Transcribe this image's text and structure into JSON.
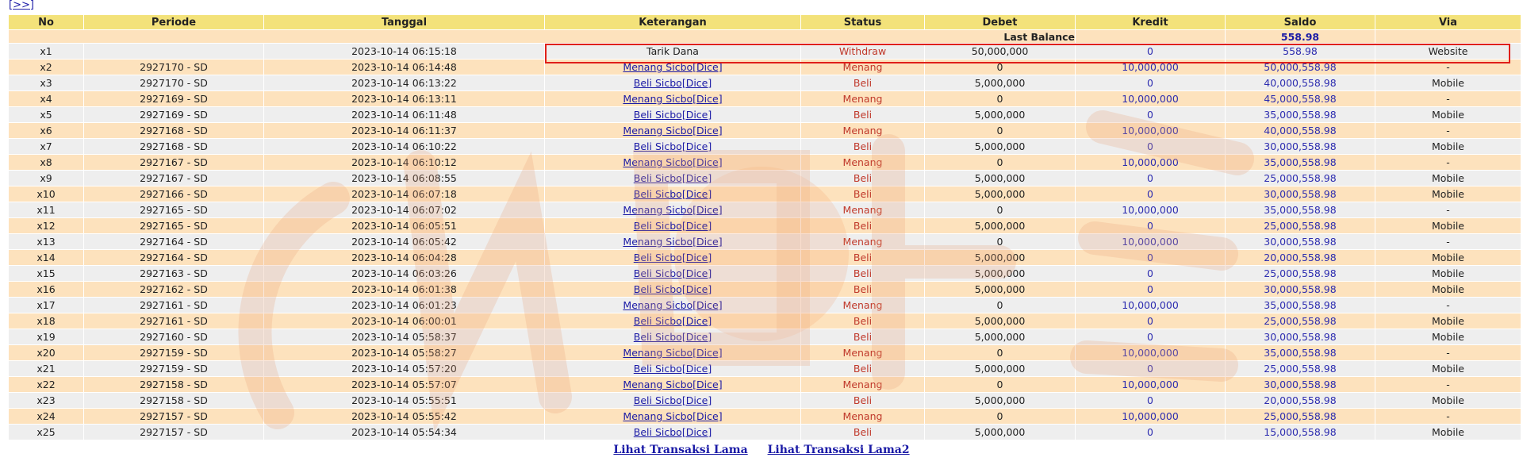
{
  "nav": {
    "next_link": "[>>]"
  },
  "table": {
    "headers": [
      "No",
      "Periode",
      "Tanggal",
      "Keterangan",
      "Status",
      "Debet",
      "Kredit",
      "Saldo",
      "Via"
    ],
    "last_balance_label": "Last Balance",
    "last_balance_value": "558.98",
    "rows": [
      {
        "no": "x1",
        "periode": "",
        "tanggal": "2023-10-14 06:15:18",
        "keterangan": "Tarik Dana",
        "status": "Withdraw",
        "debet": "50,000,000",
        "kredit": "0",
        "saldo": "558.98",
        "via": "Website"
      },
      {
        "no": "x2",
        "periode": "2927170 - SD",
        "tanggal": "2023-10-14 06:14:48",
        "keterangan": "Menang Sicbo[Dice]",
        "status": "Menang",
        "debet": "0",
        "kredit": "10,000,000",
        "saldo": "50,000,558.98",
        "via": "-"
      },
      {
        "no": "x3",
        "periode": "2927170 - SD",
        "tanggal": "2023-10-14 06:13:22",
        "keterangan": "Beli Sicbo[Dice]",
        "status": "Beli",
        "debet": "5,000,000",
        "kredit": "0",
        "saldo": "40,000,558.98",
        "via": "Mobile"
      },
      {
        "no": "x4",
        "periode": "2927169 - SD",
        "tanggal": "2023-10-14 06:13:11",
        "keterangan": "Menang Sicbo[Dice]",
        "status": "Menang",
        "debet": "0",
        "kredit": "10,000,000",
        "saldo": "45,000,558.98",
        "via": "-"
      },
      {
        "no": "x5",
        "periode": "2927169 - SD",
        "tanggal": "2023-10-14 06:11:48",
        "keterangan": "Beli Sicbo[Dice]",
        "status": "Beli",
        "debet": "5,000,000",
        "kredit": "0",
        "saldo": "35,000,558.98",
        "via": "Mobile"
      },
      {
        "no": "x6",
        "periode": "2927168 - SD",
        "tanggal": "2023-10-14 06:11:37",
        "keterangan": "Menang Sicbo[Dice]",
        "status": "Menang",
        "debet": "0",
        "kredit": "10,000,000",
        "saldo": "40,000,558.98",
        "via": "-"
      },
      {
        "no": "x7",
        "periode": "2927168 - SD",
        "tanggal": "2023-10-14 06:10:22",
        "keterangan": "Beli Sicbo[Dice]",
        "status": "Beli",
        "debet": "5,000,000",
        "kredit": "0",
        "saldo": "30,000,558.98",
        "via": "Mobile"
      },
      {
        "no": "x8",
        "periode": "2927167 - SD",
        "tanggal": "2023-10-14 06:10:12",
        "keterangan": "Menang Sicbo[Dice]",
        "status": "Menang",
        "debet": "0",
        "kredit": "10,000,000",
        "saldo": "35,000,558.98",
        "via": "-"
      },
      {
        "no": "x9",
        "periode": "2927167 - SD",
        "tanggal": "2023-10-14 06:08:55",
        "keterangan": "Beli Sicbo[Dice]",
        "status": "Beli",
        "debet": "5,000,000",
        "kredit": "0",
        "saldo": "25,000,558.98",
        "via": "Mobile"
      },
      {
        "no": "x10",
        "periode": "2927166 - SD",
        "tanggal": "2023-10-14 06:07:18",
        "keterangan": "Beli Sicbo[Dice]",
        "status": "Beli",
        "debet": "5,000,000",
        "kredit": "0",
        "saldo": "30,000,558.98",
        "via": "Mobile"
      },
      {
        "no": "x11",
        "periode": "2927165 - SD",
        "tanggal": "2023-10-14 06:07:02",
        "keterangan": "Menang Sicbo[Dice]",
        "status": "Menang",
        "debet": "0",
        "kredit": "10,000,000",
        "saldo": "35,000,558.98",
        "via": "-"
      },
      {
        "no": "x12",
        "periode": "2927165 - SD",
        "tanggal": "2023-10-14 06:05:51",
        "keterangan": "Beli Sicbo[Dice]",
        "status": "Beli",
        "debet": "5,000,000",
        "kredit": "0",
        "saldo": "25,000,558.98",
        "via": "Mobile"
      },
      {
        "no": "x13",
        "periode": "2927164 - SD",
        "tanggal": "2023-10-14 06:05:42",
        "keterangan": "Menang Sicbo[Dice]",
        "status": "Menang",
        "debet": "0",
        "kredit": "10,000,000",
        "saldo": "30,000,558.98",
        "via": "-"
      },
      {
        "no": "x14",
        "periode": "2927164 - SD",
        "tanggal": "2023-10-14 06:04:28",
        "keterangan": "Beli Sicbo[Dice]",
        "status": "Beli",
        "debet": "5,000,000",
        "kredit": "0",
        "saldo": "20,000,558.98",
        "via": "Mobile"
      },
      {
        "no": "x15",
        "periode": "2927163 - SD",
        "tanggal": "2023-10-14 06:03:26",
        "keterangan": "Beli Sicbo[Dice]",
        "status": "Beli",
        "debet": "5,000,000",
        "kredit": "0",
        "saldo": "25,000,558.98",
        "via": "Mobile"
      },
      {
        "no": "x16",
        "periode": "2927162 - SD",
        "tanggal": "2023-10-14 06:01:38",
        "keterangan": "Beli Sicbo[Dice]",
        "status": "Beli",
        "debet": "5,000,000",
        "kredit": "0",
        "saldo": "30,000,558.98",
        "via": "Mobile"
      },
      {
        "no": "x17",
        "periode": "2927161 - SD",
        "tanggal": "2023-10-14 06:01:23",
        "keterangan": "Menang Sicbo[Dice]",
        "status": "Menang",
        "debet": "0",
        "kredit": "10,000,000",
        "saldo": "35,000,558.98",
        "via": "-"
      },
      {
        "no": "x18",
        "periode": "2927161 - SD",
        "tanggal": "2023-10-14 06:00:01",
        "keterangan": "Beli Sicbo[Dice]",
        "status": "Beli",
        "debet": "5,000,000",
        "kredit": "0",
        "saldo": "25,000,558.98",
        "via": "Mobile"
      },
      {
        "no": "x19",
        "periode": "2927160 - SD",
        "tanggal": "2023-10-14 05:58:37",
        "keterangan": "Beli Sicbo[Dice]",
        "status": "Beli",
        "debet": "5,000,000",
        "kredit": "0",
        "saldo": "30,000,558.98",
        "via": "Mobile"
      },
      {
        "no": "x20",
        "periode": "2927159 - SD",
        "tanggal": "2023-10-14 05:58:27",
        "keterangan": "Menang Sicbo[Dice]",
        "status": "Menang",
        "debet": "0",
        "kredit": "10,000,000",
        "saldo": "35,000,558.98",
        "via": "-"
      },
      {
        "no": "x21",
        "periode": "2927159 - SD",
        "tanggal": "2023-10-14 05:57:20",
        "keterangan": "Beli Sicbo[Dice]",
        "status": "Beli",
        "debet": "5,000,000",
        "kredit": "0",
        "saldo": "25,000,558.98",
        "via": "Mobile"
      },
      {
        "no": "x22",
        "periode": "2927158 - SD",
        "tanggal": "2023-10-14 05:57:07",
        "keterangan": "Menang Sicbo[Dice]",
        "status": "Menang",
        "debet": "0",
        "kredit": "10,000,000",
        "saldo": "30,000,558.98",
        "via": "-"
      },
      {
        "no": "x23",
        "periode": "2927158 - SD",
        "tanggal": "2023-10-14 05:55:51",
        "keterangan": "Beli Sicbo[Dice]",
        "status": "Beli",
        "debet": "5,000,000",
        "kredit": "0",
        "saldo": "20,000,558.98",
        "via": "Mobile"
      },
      {
        "no": "x24",
        "periode": "2927157 - SD",
        "tanggal": "2023-10-14 05:55:42",
        "keterangan": "Menang Sicbo[Dice]",
        "status": "Menang",
        "debet": "0",
        "kredit": "10,000,000",
        "saldo": "25,000,558.98",
        "via": "-"
      },
      {
        "no": "x25",
        "periode": "2927157 - SD",
        "tanggal": "2023-10-14 05:54:34",
        "keterangan": "Beli Sicbo[Dice]",
        "status": "Beli",
        "debet": "5,000,000",
        "kredit": "0",
        "saldo": "15,000,558.98",
        "via": "Mobile"
      }
    ]
  },
  "footer": {
    "link1": "Lihat Transaksi Lama",
    "link2": "Lihat Transaksi Lama2"
  },
  "colors": {
    "header_bg": "#f3e27a",
    "row_odd": "#eeeeee",
    "row_even": "#fde2bd",
    "status_red": "#c0392b",
    "link_blue": "#1a1aa6",
    "highlight_red": "#e0201a"
  }
}
